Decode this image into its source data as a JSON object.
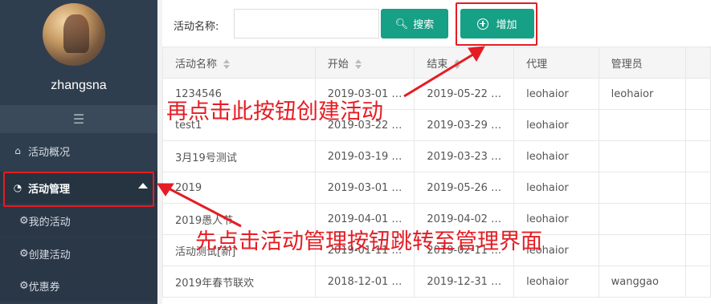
{
  "user": {
    "name": "zhangsna"
  },
  "sidebar": {
    "collapse_icon": "menu-fold-icon",
    "items": [
      {
        "label": "活动概况",
        "icon": "home-icon"
      },
      {
        "label": "活动管理",
        "icon": "dashboard-icon"
      }
    ],
    "sub_items": [
      {
        "label": "我的活动",
        "icon": "gear-icon"
      },
      {
        "label": "创建活动",
        "icon": "gear-icon"
      },
      {
        "label": "优惠券",
        "icon": "gear-icon"
      }
    ]
  },
  "toolbar": {
    "name_label": "活动名称:",
    "name_value": "",
    "search_label": "搜索",
    "add_label": "增加"
  },
  "table": {
    "columns": [
      "活动名称",
      "开始",
      "结束",
      "代理",
      "管理员"
    ],
    "rows": [
      [
        "1234546",
        "2019-03-01 …",
        "2019-05-22 …",
        "leohaior",
        "leohaior"
      ],
      [
        "test1",
        "2019-03-22 …",
        "2019-03-29 …",
        "leohaior",
        ""
      ],
      [
        "3月19号测试",
        "2019-03-19 …",
        "2019-03-23 …",
        "leohaior",
        ""
      ],
      [
        "2019",
        "2019-03-01 …",
        "2019-05-26 …",
        "leohaior",
        ""
      ],
      [
        "2019愚人节",
        "2019-04-01 …",
        "2019-04-02 …",
        "leohaior",
        ""
      ],
      [
        "活动测试[新]",
        "2019-01-11 …",
        "2019-02-11 …",
        "leohaior",
        ""
      ],
      [
        "2019年春节联欢",
        "2018-12-01 …",
        "2019-12-31 …",
        "leohaior",
        "wanggao"
      ]
    ]
  },
  "annotations": {
    "text1": "再点击此按钮创建活动",
    "text2": "先点击活动管理按钮跳转至管理界面",
    "color": "#e51c23"
  },
  "colors": {
    "sidebar": "#2f3e4e",
    "accent": "#16a085"
  }
}
